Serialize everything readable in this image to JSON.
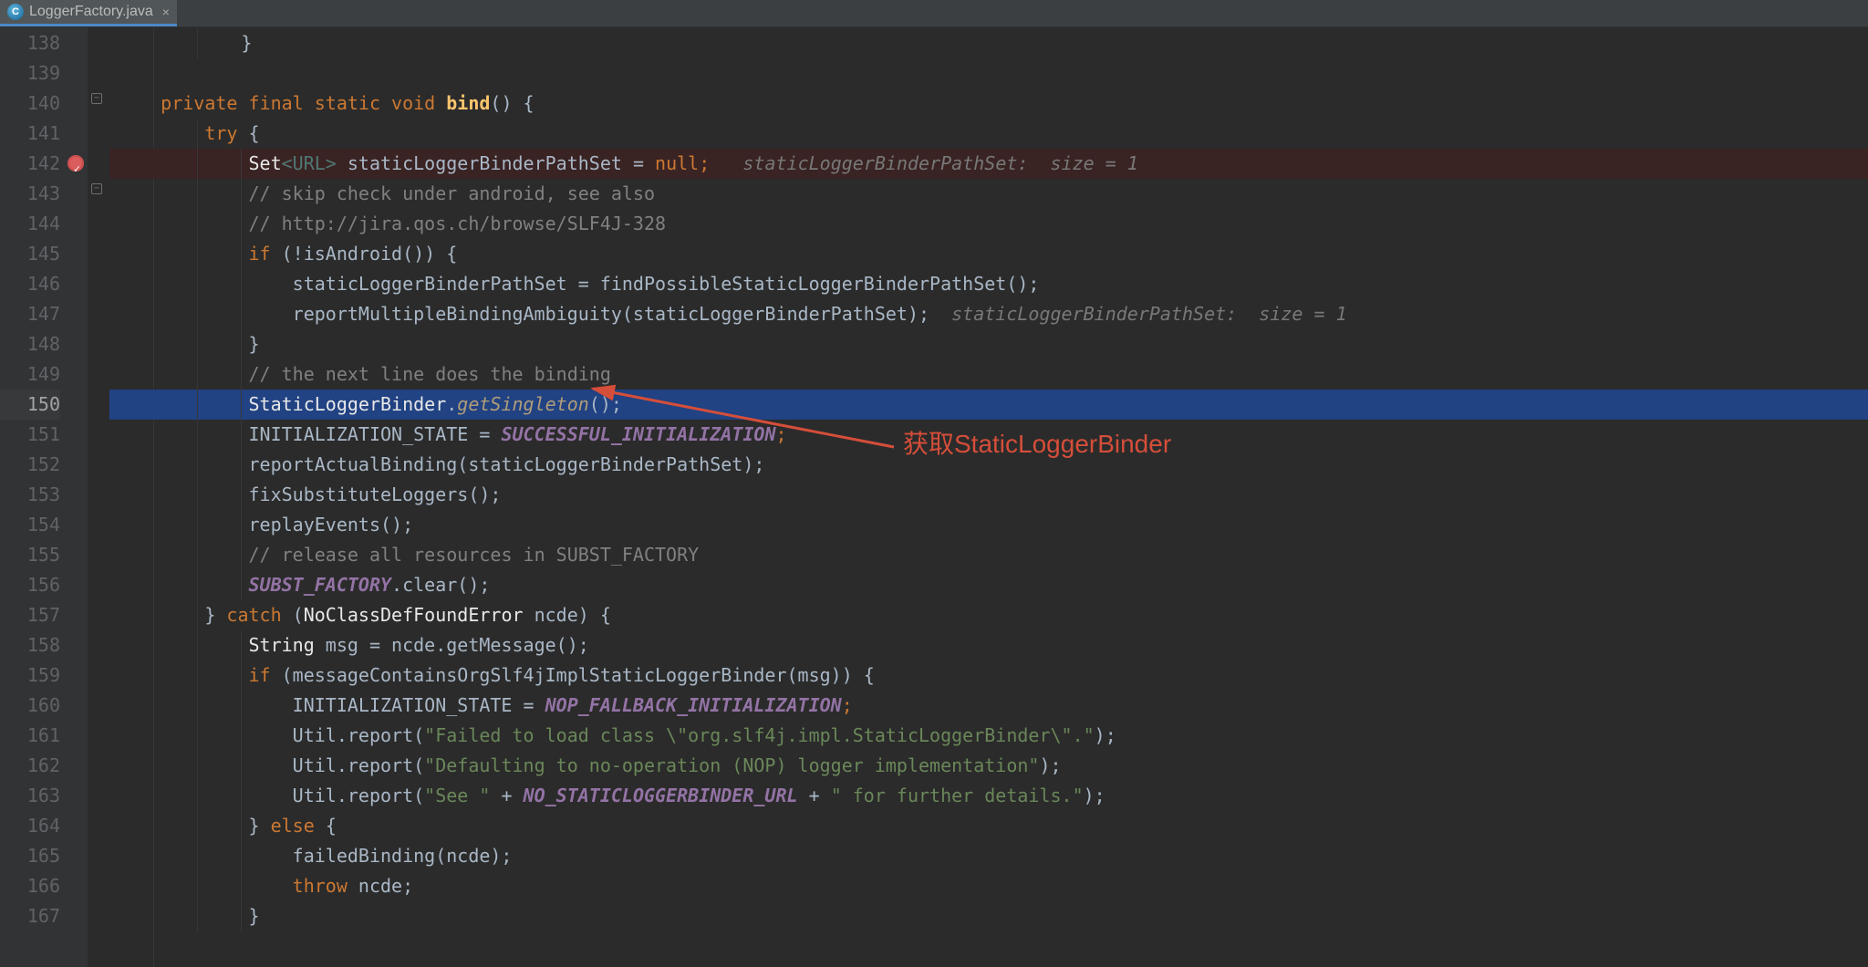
{
  "tab": {
    "filename": "LoggerFactory.java",
    "close": "×"
  },
  "gutter": {
    "start": 138,
    "breakpoint_line": 142,
    "current_line": 150,
    "end": 167
  },
  "annotation": {
    "text": "获取StaticLoggerBinder"
  },
  "code": {
    "l138": "        }",
    "l140_kw": "private final static void ",
    "l140_name": "bind",
    "l140_tail": "() {",
    "l141_try": "try ",
    "l141_brace": "{",
    "l142_set": "Set",
    "l142_gen": "<URL>",
    "l142_var": " staticLoggerBinderPathSet = ",
    "l142_null": "null",
    "l142_semi": ";",
    "l142_hint": "staticLoggerBinderPathSet:  size = 1",
    "l143": "// skip check under android, see also",
    "l144": "// http://jira.qos.ch/browse/SLF4J-328",
    "l145_if": "if ",
    "l145_cond": "(!isAndroid()) {",
    "l146": "staticLoggerBinderPathSet = findPossibleStaticLoggerBinderPathSet();",
    "l147_call": "reportMultipleBindingAmbiguity(staticLoggerBinderPathSet);",
    "l147_hint": "staticLoggerBinderPathSet:  size = 1",
    "l148": "}",
    "l149": "// the next line does the binding",
    "l150_cls": "StaticLoggerBinder",
    "l150_dot": ".",
    "l150_m": "getSingleton",
    "l150_tail": "();",
    "l151_var": "INITIALIZATION_STATE = ",
    "l151_const": "SUCCESSFUL_INITIALIZATION",
    "l151_semi": ";",
    "l152": "reportActualBinding(staticLoggerBinderPathSet);",
    "l153": "fixSubstituteLoggers();",
    "l154": "replayEvents();",
    "l155": "// release all resources in SUBST_FACTORY",
    "l156_const": "SUBST_FACTORY",
    "l156_call": ".clear();",
    "l157_close": "} ",
    "l157_catch": "catch ",
    "l157_paren": "(",
    "l157_ex": "NoClassDefFoundError",
    "l157_var": " ncde) {",
    "l158_type": "String",
    "l158_rest": " msg = ncde.getMessage();",
    "l159_if": "if ",
    "l159_rest": "(messageContainsOrgSlf4jImplStaticLoggerBinder(msg)) {",
    "l160_var": "INITIALIZATION_STATE = ",
    "l160_const": "NOP_FALLBACK_INITIALIZATION",
    "l160_semi": ";",
    "l161_pre": "Util.report(",
    "l161_str": "\"Failed to load class \\\"org.slf4j.impl.StaticLoggerBinder\\\".\"",
    "l161_post": ");",
    "l162_pre": "Util.report(",
    "l162_str": "\"Defaulting to no-operation (NOP) logger implementation\"",
    "l162_post": ");",
    "l163_pre": "Util.report(",
    "l163_str1": "\"See \"",
    "l163_plus": " + ",
    "l163_const": "NO_STATICLOGGERBINDER_URL",
    "l163_plus2": " + ",
    "l163_str2": "\" for further details.\"",
    "l163_post": ");",
    "l164_close": "} ",
    "l164_else": "else ",
    "l164_brace": "{",
    "l165": "failedBinding(ncde);",
    "l166_throw": "throw ",
    "l166_var": "ncde;",
    "l167": "}"
  }
}
